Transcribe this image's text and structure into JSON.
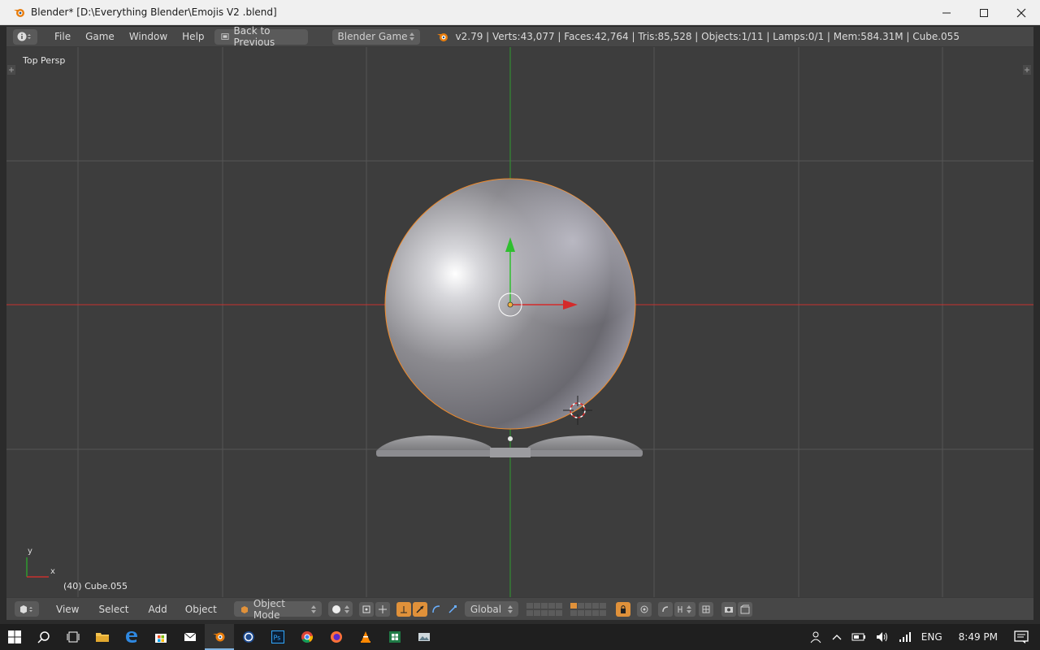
{
  "window": {
    "title": "Blender* [D:\\Everything Blender\\Emojis V2 .blend]"
  },
  "infobar": {
    "menus": [
      "File",
      "Game",
      "Window",
      "Help"
    ],
    "back_label": "Back to Previous",
    "engine": "Blender Game",
    "stats": "v2.79 | Verts:43,077 | Faces:42,764 | Tris:85,528 | Objects:1/11 | Lamps:0/1 | Mem:584.31M | Cube.055"
  },
  "viewport": {
    "view_label": "Top Persp",
    "object_label": "(40) Cube.055",
    "axis_y": "y",
    "axis_x": "x"
  },
  "bottombar": {
    "menus": [
      "View",
      "Select",
      "Add",
      "Object"
    ],
    "mode": "Object Mode",
    "orientation": "Global"
  },
  "taskbar": {
    "lang": "ENG",
    "time": "8:49 PM"
  },
  "colors": {
    "viewport_bg": "#3d3d3d",
    "x_axis": "#c8312f",
    "y_axis": "#2e9b2e",
    "selection": "#f08a2a",
    "active_tool": "#e0913a"
  }
}
